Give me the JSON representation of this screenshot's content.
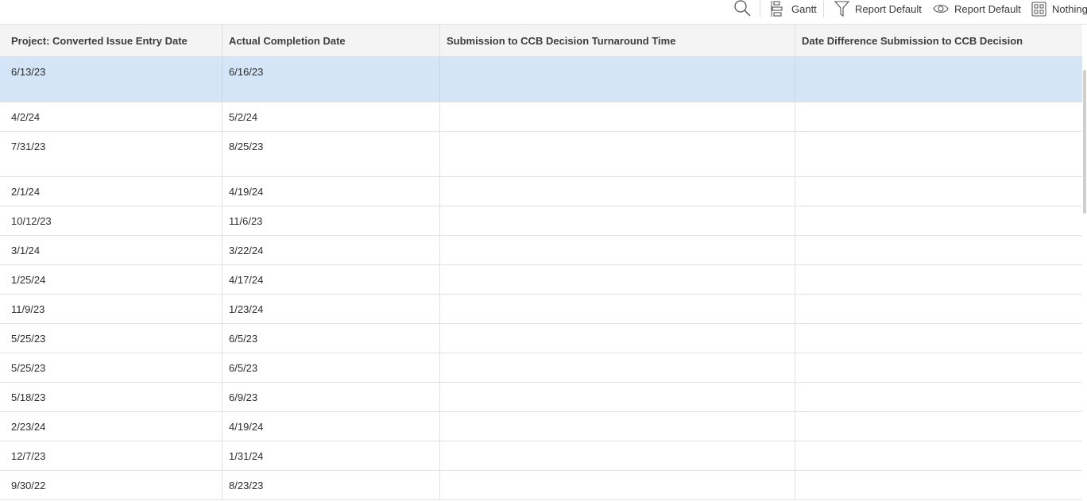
{
  "toolbar": {
    "gantt_label": "Gantt",
    "filter_label": "Report Default",
    "view_label": "Report Default",
    "grouping_label": "Nothing"
  },
  "table": {
    "columns": [
      "Project: Converted Issue Entry Date",
      "Actual Completion Date",
      "Submission to CCB Decision Turnaround Time",
      "Date Difference Submission to CCB Decision"
    ],
    "rows": [
      [
        "6/13/23",
        "6/16/23",
        "",
        ""
      ],
      [
        "4/2/24",
        "5/2/24",
        "",
        ""
      ],
      [
        "7/31/23",
        "8/25/23",
        "",
        ""
      ],
      [
        "2/1/24",
        "4/19/24",
        "",
        ""
      ],
      [
        "10/12/23",
        "11/6/23",
        "",
        ""
      ],
      [
        "3/1/24",
        "3/22/24",
        "",
        ""
      ],
      [
        "1/25/24",
        "4/17/24",
        "",
        ""
      ],
      [
        "11/9/23",
        "1/23/24",
        "",
        ""
      ],
      [
        "5/25/23",
        "6/5/23",
        "",
        ""
      ],
      [
        "5/25/23",
        "6/5/23",
        "",
        ""
      ],
      [
        "5/18/23",
        "6/9/23",
        "",
        ""
      ],
      [
        "2/23/24",
        "4/19/24",
        "",
        ""
      ],
      [
        "12/7/23",
        "1/31/24",
        "",
        ""
      ],
      [
        "9/30/22",
        "8/23/23",
        "",
        ""
      ]
    ]
  },
  "colors": {
    "selected_row": "#d5e5f8",
    "header_bg": "#f4f4f4",
    "grid_line": "#e0e0e0"
  }
}
